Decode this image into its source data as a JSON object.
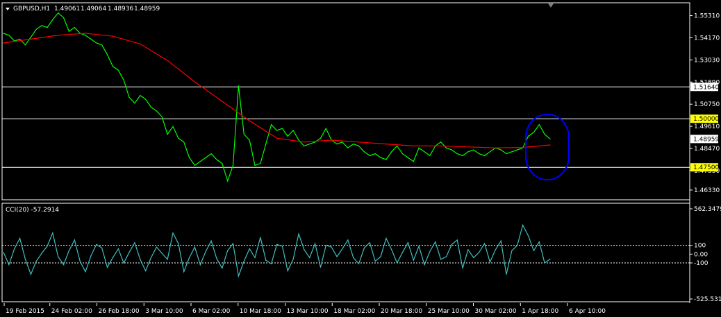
{
  "chart_data": [
    {
      "type": "line",
      "symbol": "GBPUSD,H1",
      "ohlc": [
        "1.49061",
        "1.49064",
        "1.48936",
        "1.48959"
      ],
      "ylim": [
        1.459,
        1.559
      ],
      "yticks": [
        "1.55310",
        "1.54170",
        "1.53030",
        "1.51890",
        "1.50750",
        "1.49610",
        "1.48470",
        "1.47330",
        "1.46330"
      ],
      "ytick_values": [
        1.5531,
        1.5417,
        1.5303,
        1.5189,
        1.5075,
        1.4961,
        1.4847,
        1.4733,
        1.4633
      ],
      "hlines": [
        {
          "label": "1.51640",
          "value": 1.5164,
          "highlight": false
        },
        {
          "label": "1.50000",
          "value": 1.5,
          "highlight": true
        },
        {
          "label": "1.47500",
          "value": 1.475,
          "highlight": true
        }
      ],
      "current_price": {
        "label": "1.48959",
        "value": 1.48959
      },
      "xlabels": [
        "19 Feb 2015",
        "24 Feb 02:00",
        "26 Feb 18:00",
        "3 Mar 10:00",
        "6 Mar 02:00",
        "10 Mar 18:00",
        "13 Mar 10:00",
        "18 Mar 02:00",
        "20 Mar 18:00",
        "25 Mar 10:00",
        "30 Mar 02:00",
        "1 Apr 18:00",
        "6 Apr 10:00"
      ],
      "series": [
        {
          "color": "#00ff00",
          "x": [
            0,
            2,
            4,
            6,
            8,
            10,
            12,
            14,
            16,
            18,
            20,
            22,
            24,
            26,
            28,
            30,
            32,
            34,
            36,
            38,
            40,
            42,
            44,
            46,
            48,
            50,
            52,
            54,
            56,
            58,
            60,
            62,
            64,
            66,
            68,
            70,
            72,
            74,
            76,
            78,
            80,
            82,
            84,
            86,
            88,
            90,
            92,
            94,
            96,
            98,
            100,
            102,
            104,
            106,
            108,
            110,
            112,
            114,
            116,
            118,
            120,
            122,
            124,
            126,
            128,
            130,
            132,
            134,
            136,
            138,
            140,
            142,
            144,
            146,
            148,
            150,
            152,
            154,
            156,
            158,
            160,
            162,
            164,
            166,
            168,
            170,
            172,
            174,
            176,
            178,
            180,
            182,
            184,
            186,
            188,
            190,
            192,
            194,
            196,
            198,
            200
          ],
          "values": [
            1.544,
            1.543,
            1.54,
            1.541,
            1.538,
            1.542,
            1.546,
            1.548,
            1.547,
            1.551,
            1.5545,
            1.552,
            1.545,
            1.547,
            1.544,
            1.543,
            1.541,
            1.539,
            1.538,
            1.533,
            1.527,
            1.525,
            1.52,
            1.511,
            1.508,
            1.512,
            1.51,
            1.506,
            1.504,
            1.501,
            1.492,
            1.496,
            1.49,
            1.488,
            1.48,
            1.476,
            1.478,
            1.48,
            1.482,
            1.479,
            1.477,
            1.468,
            1.476,
            1.517,
            1.492,
            1.489,
            1.476,
            1.477,
            1.487,
            1.497,
            1.494,
            1.495,
            1.491,
            1.494,
            1.489,
            1.486,
            1.487,
            1.488,
            1.49,
            1.495,
            1.489,
            1.487,
            1.488,
            1.485,
            1.487,
            1.486,
            1.483,
            1.481,
            1.482,
            1.48,
            1.479,
            1.483,
            1.486,
            1.482,
            1.48,
            1.478,
            1.485,
            1.483,
            1.481,
            1.486,
            1.488,
            1.485,
            1.484,
            1.482,
            1.481,
            1.483,
            1.484,
            1.482,
            1.481,
            1.483,
            1.485,
            1.484,
            1.482,
            1.483,
            1.484,
            1.485,
            1.491,
            1.493,
            1.497,
            1.492,
            1.4896
          ]
        },
        {
          "color": "#ff0000",
          "x": [
            0,
            10,
            20,
            30,
            40,
            50,
            60,
            70,
            80,
            90,
            100,
            110,
            120,
            130,
            140,
            150,
            160,
            170,
            180,
            190,
            200
          ],
          "values": [
            1.539,
            1.541,
            1.543,
            1.544,
            1.5425,
            1.5385,
            1.53,
            1.519,
            1.509,
            1.499,
            1.49,
            1.488,
            1.489,
            1.488,
            1.487,
            1.486,
            1.486,
            1.4855,
            1.485,
            1.4852,
            1.4865
          ]
        }
      ],
      "annotation": {
        "type": "ellipse",
        "color": "#0000ff"
      }
    },
    {
      "type": "line",
      "label": "CCI(20) -57.2914",
      "ylim": [
        -525.5311,
        562.3479
      ],
      "yticks": [
        "562.3479",
        "100",
        "0.00",
        "-100",
        "-525.5311"
      ],
      "ytick_values": [
        562.3479,
        100,
        0,
        -100,
        -525.5311
      ],
      "levels": [
        100,
        -100
      ],
      "series": [
        {
          "color": "#40c0c0",
          "x": [
            0,
            2,
            4,
            6,
            8,
            10,
            12,
            14,
            16,
            18,
            20,
            22,
            24,
            26,
            28,
            30,
            32,
            34,
            36,
            38,
            40,
            42,
            44,
            46,
            48,
            50,
            52,
            54,
            56,
            58,
            60,
            62,
            64,
            66,
            68,
            70,
            72,
            74,
            76,
            78,
            80,
            82,
            84,
            86,
            88,
            90,
            92,
            94,
            96,
            98,
            100,
            102,
            104,
            106,
            108,
            110,
            112,
            114,
            116,
            118,
            120,
            122,
            124,
            126,
            128,
            130,
            132,
            134,
            136,
            138,
            140,
            142,
            144,
            146,
            148,
            150,
            152,
            154,
            156,
            158,
            160,
            162,
            164,
            166,
            168,
            170,
            172,
            174,
            176,
            178,
            180,
            182,
            184,
            186,
            188,
            190,
            192,
            194,
            196,
            198,
            200
          ],
          "values": [
            20,
            -120,
            60,
            180,
            -60,
            -230,
            -80,
            10,
            90,
            240,
            -30,
            -120,
            40,
            160,
            -80,
            -200,
            -20,
            110,
            70,
            -150,
            -40,
            60,
            -100,
            20,
            130,
            -60,
            -190,
            -40,
            80,
            10,
            -60,
            240,
            120,
            -200,
            -40,
            80,
            -120,
            30,
            150,
            -50,
            -160,
            40,
            120,
            -250,
            -80,
            60,
            -40,
            190,
            -70,
            -110,
            110,
            90,
            -190,
            -60,
            230,
            50,
            -40,
            120,
            -150,
            100,
            80,
            -30,
            60,
            160,
            -40,
            -110,
            70,
            130,
            -80,
            -30,
            180,
            50,
            -100,
            20,
            130,
            -70,
            90,
            -120,
            30,
            140,
            -60,
            -30,
            110,
            160,
            -160,
            50,
            -40,
            20,
            120,
            -90,
            50,
            150,
            -230,
            40,
            100,
            330,
            210,
            40,
            140,
            -100,
            -57
          ]
        }
      ]
    }
  ]
}
